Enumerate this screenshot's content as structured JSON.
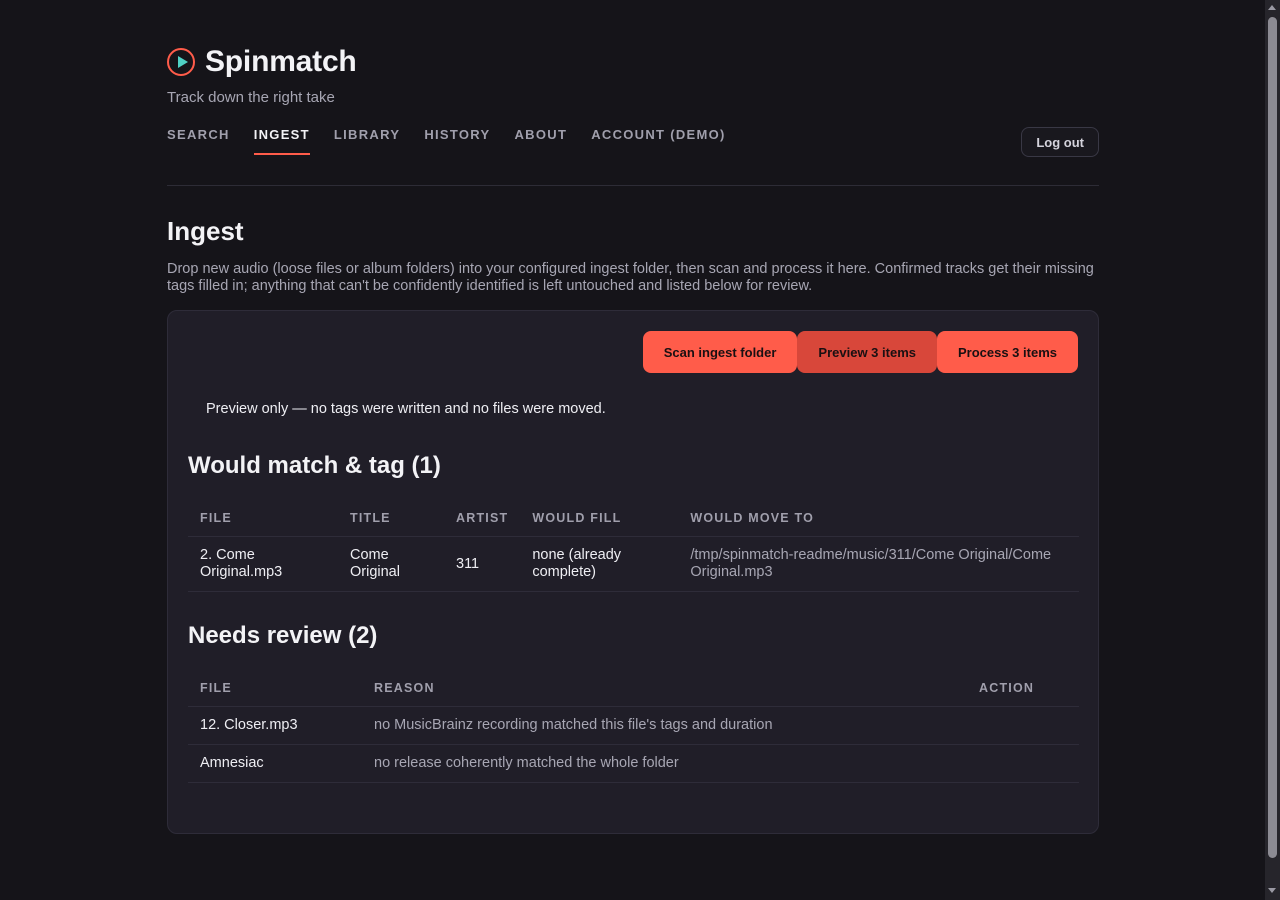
{
  "app": {
    "name": "Spinmatch",
    "tagline": "Track down the right take"
  },
  "nav": {
    "items": [
      {
        "label": "SEARCH"
      },
      {
        "label": "INGEST",
        "active": true
      },
      {
        "label": "LIBRARY"
      },
      {
        "label": "HISTORY"
      },
      {
        "label": "ABOUT"
      },
      {
        "label": "ACCOUNT (DEMO)"
      }
    ],
    "logout_label": "Log out"
  },
  "page": {
    "title": "Ingest",
    "description": "Drop new audio (loose files or album folders) into your configured ingest folder, then scan and process it here. Confirmed tracks get their missing tags filled in; anything that can't be confidently identified is left untouched and listed below for review."
  },
  "actions": {
    "scan_label": "Scan ingest folder",
    "preview_label": "Preview 3 items",
    "process_label": "Process 3 items"
  },
  "notice": "Preview only — no tags were written and no files were moved.",
  "match_section": {
    "heading": "Would match & tag (1)",
    "columns": [
      "FILE",
      "TITLE",
      "ARTIST",
      "WOULD FILL",
      "WOULD MOVE TO"
    ],
    "rows": [
      {
        "file": "2. Come Original.mp3",
        "title": "Come Original",
        "artist": "311",
        "would_fill": "none (already complete)",
        "would_move_to": "/tmp/spinmatch-readme/music/311/Come Original/Come Original.mp3"
      }
    ]
  },
  "review_section": {
    "heading": "Needs review (2)",
    "columns": [
      "FILE",
      "REASON",
      "ACTION"
    ],
    "rows": [
      {
        "file": "12. Closer.mp3",
        "reason": "no MusicBrainz recording matched this file's tags and duration",
        "action": ""
      },
      {
        "file": "Amnesiac",
        "reason": "no release coherently matched the whole folder",
        "action": ""
      }
    ]
  },
  "colors": {
    "accent": "#ff5c4a",
    "accent_pressed": "#d8473a",
    "logo_play": "#4fd1c5",
    "background": "#151419",
    "card": "#201e28"
  }
}
